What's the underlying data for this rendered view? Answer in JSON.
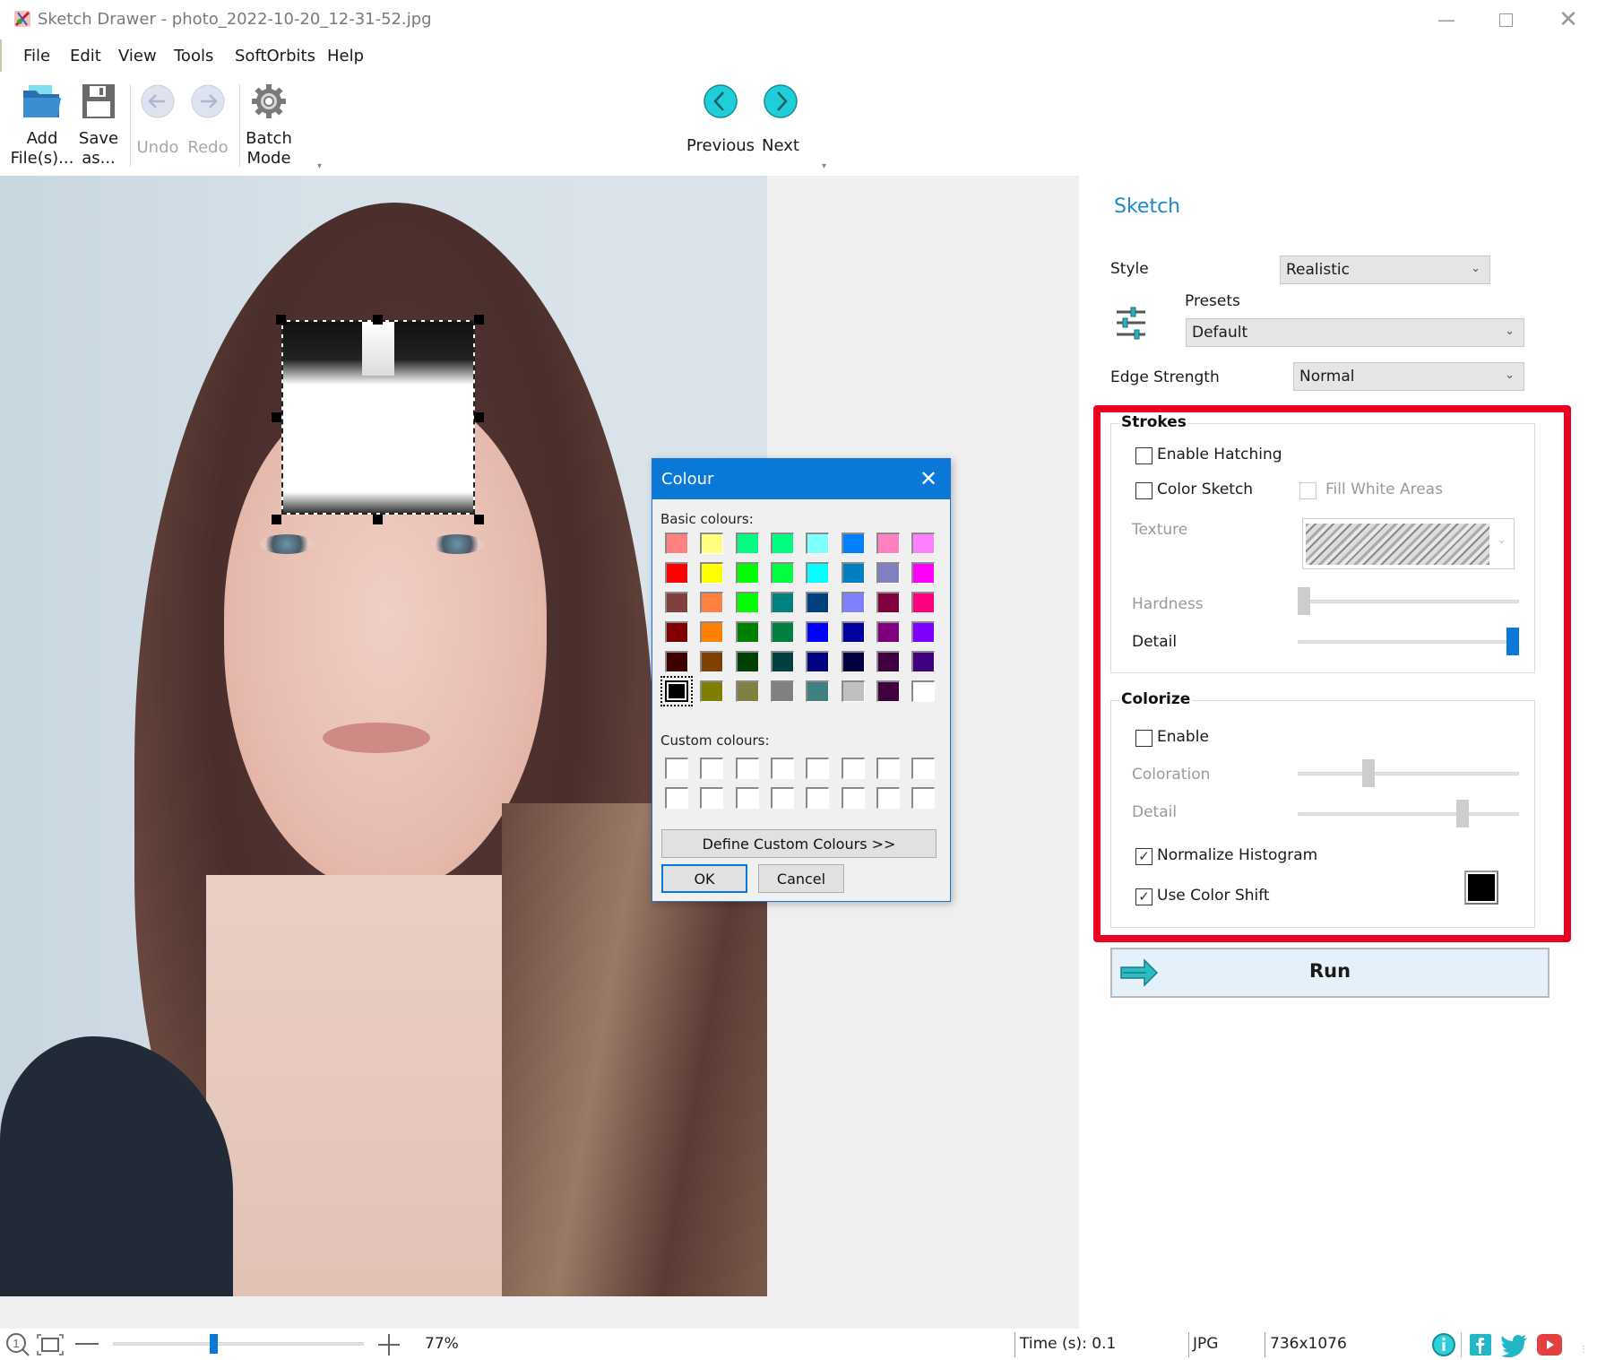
{
  "window": {
    "title": "Sketch Drawer - photo_2022-10-20_12-31-52.jpg",
    "controls": [
      "minimize",
      "maximize",
      "close"
    ]
  },
  "menu": {
    "items": [
      {
        "label": "File",
        "accel": "F"
      },
      {
        "label": "Edit",
        "accel": "E"
      },
      {
        "label": "View",
        "accel": "V"
      },
      {
        "label": "Tools",
        "accel": "T"
      },
      {
        "label": "SoftOrbits",
        "accel": ""
      },
      {
        "label": "Help",
        "accel": "H"
      }
    ]
  },
  "toolbar": {
    "add_files": {
      "line1": "Add",
      "line2": "File(s)...",
      "icon": "folder-open-icon"
    },
    "save_as": {
      "line1": "Save",
      "line2": "as...",
      "icon": "floppy-disk-icon"
    },
    "undo": {
      "label": "Undo",
      "icon": "undo-arrow-icon",
      "enabled": false
    },
    "redo": {
      "label": "Redo",
      "icon": "redo-arrow-icon",
      "enabled": false
    },
    "batch_mode": {
      "line1": "Batch",
      "line2": "Mode",
      "icon": "gear-icon"
    },
    "previous": {
      "label": "Previous",
      "icon": "chevron-left-circle-icon"
    },
    "next": {
      "label": "Next",
      "icon": "chevron-right-circle-icon"
    }
  },
  "colour_dialog": {
    "title": "Colour",
    "basic_label": "Basic colours:",
    "basic_colours": [
      [
        "#ff8080",
        "#ffff80",
        "#00ff80",
        "#00ff80",
        "#80ffff",
        "#0080ff",
        "#ff80c0",
        "#ff80ff"
      ],
      [
        "#ff0000",
        "#ffff00",
        "#00ff00",
        "#00ff40",
        "#00ffff",
        "#0080c0",
        "#8080c0",
        "#ff00ff"
      ],
      [
        "#804040",
        "#ff8040",
        "#00ff00",
        "#008080",
        "#004080",
        "#8080ff",
        "#800040",
        "#ff0080"
      ],
      [
        "#800000",
        "#ff8000",
        "#008000",
        "#008040",
        "#0000ff",
        "#0000a0",
        "#800080",
        "#8000ff"
      ],
      [
        "#400000",
        "#804000",
        "#004000",
        "#004040",
        "#000080",
        "#000040",
        "#400040",
        "#400080"
      ],
      [
        "#000000",
        "#808000",
        "#808040",
        "#808080",
        "#408080",
        "#c0c0c0",
        "#400040",
        "#ffffff"
      ]
    ],
    "selected": {
      "row": 5,
      "col": 0
    },
    "custom_label": "Custom colours:",
    "custom_count": 16,
    "define_button": "Define Custom Colours >>",
    "ok_button": "OK",
    "cancel_button": "Cancel"
  },
  "panel": {
    "title": "Sketch",
    "style_label": "Style",
    "style_value": "Realistic",
    "presets_label": "Presets",
    "presets_value": "Default",
    "edge_label": "Edge Strength",
    "edge_value": "Normal",
    "strokes": {
      "title": "Strokes",
      "enable_hatching": {
        "label": "Enable Hatching",
        "checked": false
      },
      "color_sketch": {
        "label": "Color Sketch",
        "checked": false
      },
      "fill_white": {
        "label": "Fill White Areas",
        "checked": false,
        "enabled": false
      },
      "texture_label": "Texture",
      "hardness_label": "Hardness",
      "hardness_value": 0.0,
      "detail_label": "Detail",
      "detail_value": 1.0
    },
    "colorize": {
      "title": "Colorize",
      "enable": {
        "label": "Enable",
        "checked": false
      },
      "coloration_label": "Coloration",
      "coloration_value": 0.31,
      "detail_label": "Detail",
      "detail_value": 0.76,
      "normalize": {
        "label": "Normalize Histogram",
        "checked": true
      },
      "color_shift": {
        "label": "Use Color Shift",
        "checked": true
      },
      "shift_color": "#000000"
    },
    "run_label": "Run",
    "highlight_color": "#ea0021"
  },
  "status": {
    "zoom": "77%",
    "zoom_value": 0.4,
    "time": "Time (s): 0.1",
    "format": "JPG",
    "dimensions": "736x1076",
    "social": [
      "info-icon",
      "facebook-icon",
      "twitter-icon",
      "youtube-icon"
    ]
  },
  "accent": "#0a78d7"
}
